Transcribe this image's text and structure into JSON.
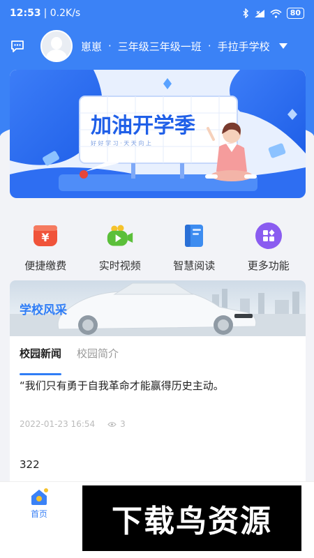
{
  "status_bar": {
    "time": "12:53",
    "speed": "| 0.2K/s",
    "battery": "80"
  },
  "header": {
    "user_name": "崽崽",
    "class_name": "三年级三年级一班",
    "school_name": "手拉手学校",
    "sep": "·"
  },
  "banner": {
    "title": "加油开学季",
    "subtitle": "好 好 学 习 · 天 天 向 上"
  },
  "features": [
    {
      "label": "便捷缴费",
      "icon": "yuan-payment-icon",
      "color": "#f0533a"
    },
    {
      "label": "实时视频",
      "icon": "video-camera-icon",
      "color": "#5bbf3a"
    },
    {
      "label": "智慧阅读",
      "icon": "book-icon",
      "color": "#3d8cf0"
    },
    {
      "label": "更多功能",
      "icon": "grid-more-icon",
      "color": "#8a5cf0"
    }
  ],
  "campus": {
    "title": "学校风采",
    "tabs": [
      "校园新闻",
      "校园简介"
    ],
    "news_title": "“我们只有勇于自我革命才能赢得历史主动。",
    "news_date": "2022-01-23 16:54",
    "news_views": "3",
    "news_body": "322"
  },
  "tabbar": {
    "home_label": "首页"
  },
  "watermark": {
    "text": "下载鸟资源"
  },
  "colors": {
    "primary": "#3b82f6"
  }
}
